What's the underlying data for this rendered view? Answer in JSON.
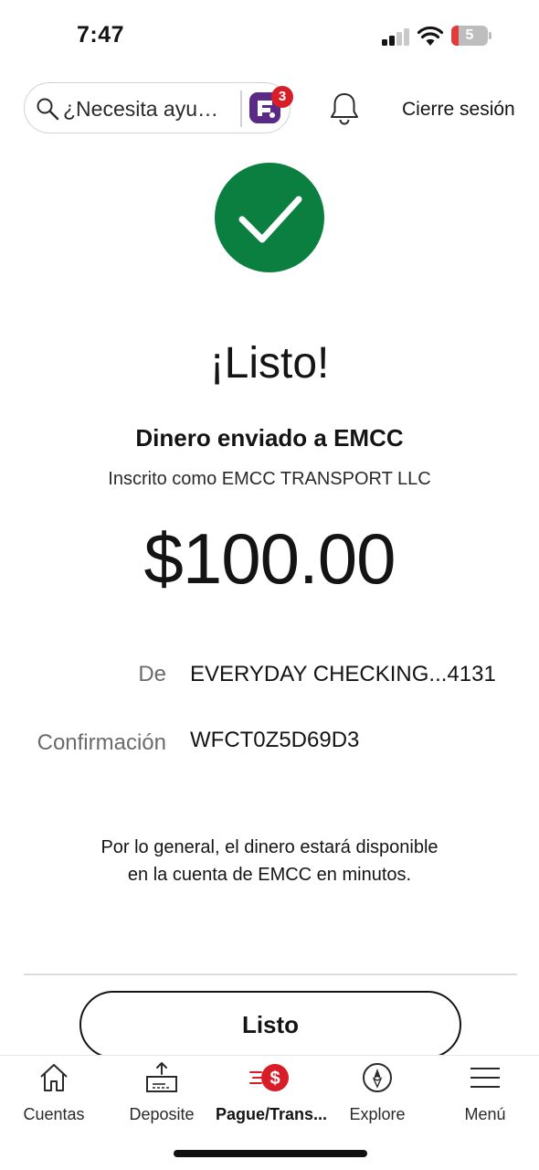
{
  "status_bar": {
    "time": "7:47",
    "battery_level": "5",
    "battery_color": "#e23b3b"
  },
  "header": {
    "search_placeholder": "¿Necesita ayu…",
    "assistant_badge_count": "3",
    "logout_label": "Cierre sesión",
    "icons": [
      "search-icon",
      "assistant-icon",
      "bell-icon"
    ]
  },
  "confirmation": {
    "icon": "checkmark-icon",
    "accent_color": "#0a7f3f",
    "title": "¡Listo!",
    "recipient_line": "Dinero enviado a EMCC",
    "enrolled_line": "Inscrito como EMCC TRANSPORT LLC",
    "amount": "$100.00"
  },
  "details": [
    {
      "label": "De",
      "value": "EVERYDAY CHECKING...4131"
    },
    {
      "label": "Confirmación",
      "value": "WFCT0Z5D69D3"
    }
  ],
  "note": "Por lo general, el dinero estará disponible en la cuenta de EMCC en minutos.",
  "done_button_label": "Listo",
  "brand_color": "#d71e28",
  "bottom_nav": [
    {
      "label": "Cuentas",
      "icon": "home-icon",
      "active": false
    },
    {
      "label": "Deposite",
      "icon": "deposit-icon",
      "active": false
    },
    {
      "label": "Pague/Trans...",
      "icon": "pay-transfer-icon",
      "active": true
    },
    {
      "label": "Explore",
      "icon": "compass-icon",
      "active": false
    },
    {
      "label": "Menú",
      "icon": "hamburger-menu-icon",
      "active": false
    }
  ]
}
